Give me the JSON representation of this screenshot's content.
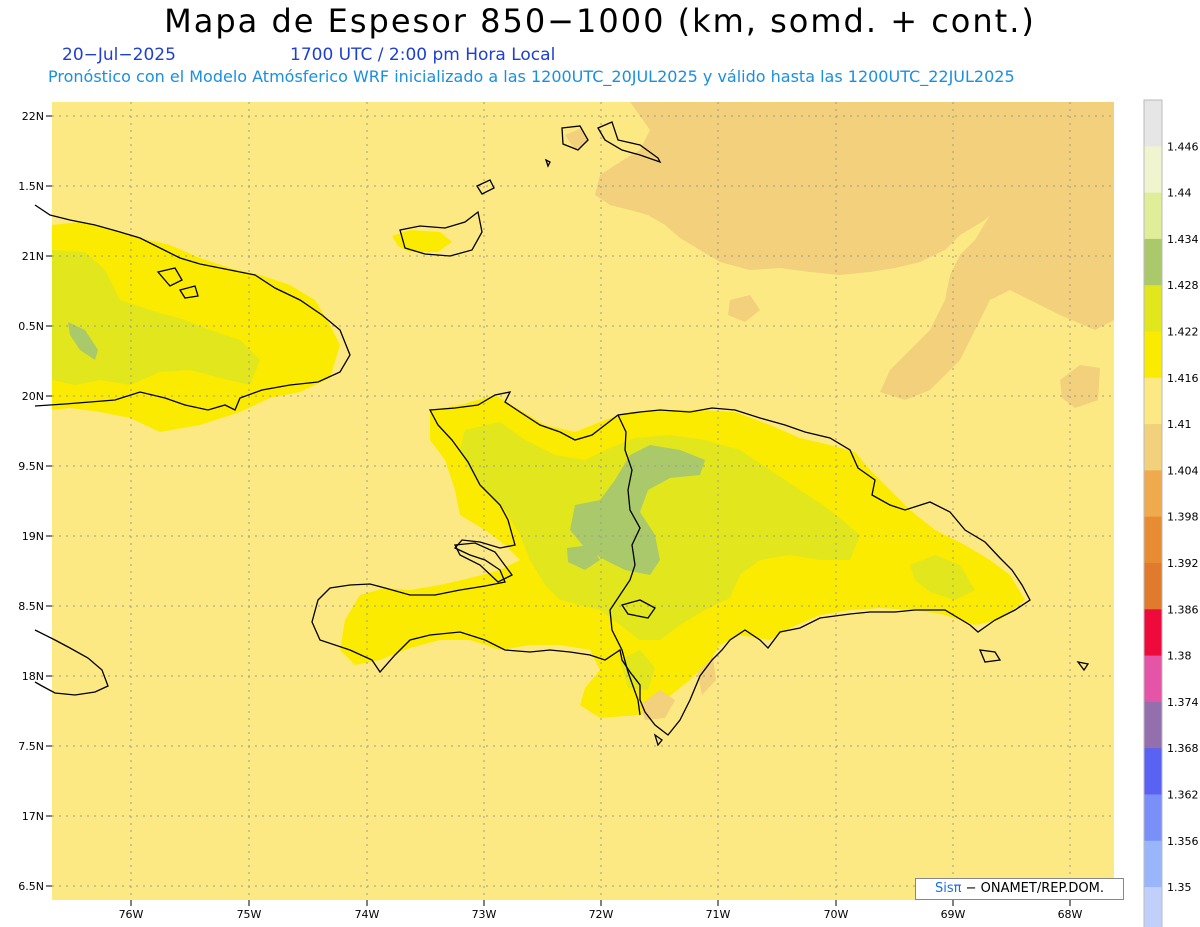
{
  "header": {
    "title": "Mapa de Espesor 850−1000 (km, somd. + cont.)",
    "date": "20−Jul−2025",
    "time": "1700 UTC / 2:00 pm Hora Local",
    "subtitle": "Pronóstico con el Modelo Atmósferico WRF inicializado a las 1200UTC_20JUL2025 y válido hasta las  1200UTC_22JUL2025"
  },
  "axes": {
    "lat_labels": [
      "22N",
      "1.5N",
      "21N",
      "0.5N",
      "20N",
      "9.5N",
      "19N",
      "8.5N",
      "18N",
      "7.5N",
      "17N",
      "6.5N"
    ],
    "lon_labels": [
      "76W",
      "75W",
      "74W",
      "73W",
      "72W",
      "71W",
      "70W",
      "69W",
      "68W"
    ]
  },
  "colorbar": {
    "labels": [
      "1.446",
      "1.44",
      "1.434",
      "1.428",
      "1.422",
      "1.416",
      "1.41",
      "1.404",
      "1.398",
      "1.392",
      "1.386",
      "1.38",
      "1.374",
      "1.368",
      "1.362",
      "1.356",
      "1.35"
    ],
    "colors": [
      "#e6e6e6",
      "#f0f4cf",
      "#e0ee9a",
      "#a9c96a",
      "#e2e61c",
      "#fbeb00",
      "#fde983",
      "#f2d07c",
      "#eeaa4c",
      "#e88c33",
      "#e07a2c",
      "#ee0a3a",
      "#e455a8",
      "#946fad",
      "#5a62f4",
      "#7a90f8",
      "#9ab6fb",
      "#c0d0fb"
    ]
  },
  "colors": {
    "background_field": "#fde983",
    "low_field": "#f2d07c",
    "mid_field": "#fbeb00",
    "high_field": "#e2e61c",
    "peak_field": "#a9c96a"
  },
  "credit": {
    "brand": "Sisπ",
    "text": " − ONAMET/REP.DOM."
  }
}
